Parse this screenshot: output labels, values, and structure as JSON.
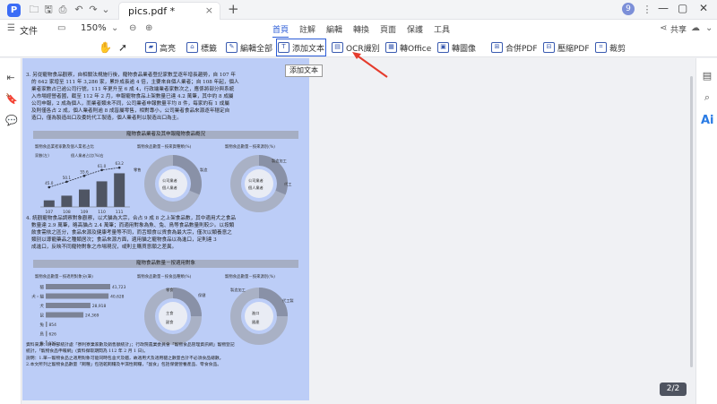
{
  "titlebar": {
    "tab_title": "pics.pdf *",
    "close_glyph": "×",
    "add_glyph": "+",
    "badge": "9",
    "win_min": "—",
    "win_max": "▢",
    "win_close": "✕"
  },
  "menubar": {
    "file": "文件",
    "zoom": "150%",
    "tabs": [
      "首頁",
      "註解",
      "編輯",
      "轉換",
      "頁面",
      "保護",
      "工具"
    ],
    "share": "共享"
  },
  "toolbar": {
    "items": [
      "高亮",
      "標籤",
      "編輯全部",
      "添加文本",
      "OCR識別",
      "轉Office",
      "轉圖像",
      "合併PDF",
      "壓縮PDF",
      "裁剪"
    ]
  },
  "tooltip": "添加文本",
  "page_indicator": "2/2",
  "document": {
    "para3": [
      "3. 另從寵物食品觀察，自相關法規施行後，寵物食品業者登記家數呈逐年增長趨勢，自 107 年",
      "的 642 家增至 111 年 3,286 家，累計成長逾 4 倍，主要來自個人業者；自 108 年起，個人",
      "業者家數占已逾公司行號，111 年更升至 6 成 4，行政端業者家數次之，應係將部分與系統",
      "入市場經營者國，截至 112 年 2 月，申報寵物食品上架數量已達 4.2 萬筆，其中約 8 成屬",
      "公司申報，2 成為個人，而業者類未不同，公司業者申報數量平均 8 件，每家約有 1 成屬",
      "及則僅各占 2 成，個人業者則逾 8 成皆屬零售，相對專小，公司業者食品來源逐年穩定自",
      "造口，僅為製造出口及委託代工製造，個人業者則以製造出口為主。"
    ],
    "band1": "寵物食品業者及其申報寵物食品概況",
    "para4": [
      "4. 統觀寵物食品調察對象觀察，以犬貓為大宗，合占 9 成 8 之上架食品數，其中適用犬之食品",
      "數量達 2.9 萬筆，略高貓占 2.4 萬筆；而適用對象為魚、兔、鳥等食品數量則較少。以按類",
      "飲食需依之區分，食品來源及健康考量等不同，而舌頭食以貨食為最大宗，僅次以類養意之",
      "類別以導寵藥品之種類居次；食品來源方面，適用貓之寵物食品以為進口，足則達 3",
      "成進口，反映不同寵物對象之市場現況，或則主購買意願之差異。"
    ],
    "band2": "寵物食品數量－按適用對象",
    "footnote": [
      "資料來源：財政部統計處「寮利寮業家數及銷售額統計」；行政院農業委員會「寵物食品管理資訊網」寵物登記",
      "        統計，「寵物食品申報網」(資料擷取期間為 112 年 2 月 1 日)。",
      "說明：1.單一寵物食品之適用對象可能同時包含犬及貓，故適用犬及適用貓之數量合計不必須食品總數。",
      "     2.本文所列之寵物食品數量「飼種」包括乾飼糧及半濕性飼糧，「副食」包括保健營養產品、零食食品。"
    ]
  },
  "charts": {
    "c1_title": "寵物食品業者家數及個人業者占比",
    "c2_title": "寵物食品數量－按來貨種類(%)",
    "c3_title": "寵物食品數量－按來源別(%)",
    "c4_title": "寵物食品數量－按適用對象分(筆)",
    "c5_title": "寵物食品數量－按食品種類(%)",
    "c6_title": "寵物食品數量－按來源別(%)",
    "c1_legend": [
      "家數(左)",
      "個人業者占比(%)右"
    ],
    "c2_labels": [
      "公司業者",
      "個人業者",
      "零售",
      "製造"
    ],
    "c3_labels": [
      "公司業者",
      "個人業者",
      "製造加工",
      "代工"
    ],
    "c5_labels": [
      "主食",
      "副食",
      "零食",
      "保健"
    ],
    "c6_labels": [
      "進口",
      "國產",
      "製造加工",
      "代工製"
    ]
  },
  "chart_data": [
    {
      "type": "bar",
      "title": "寵物食品業者家數及個人業者占比",
      "categories": [
        "107",
        "108",
        "109",
        "110",
        "111"
      ],
      "series": [
        {
          "name": "家數(左)",
          "values": [
            642,
            1100,
            1700,
            2500,
            3286
          ]
        },
        {
          "name": "個人業者占比(%)右",
          "values": [
            45.0,
            50.1,
            55.6,
            61.0,
            63.2
          ]
        }
      ],
      "data_labels": [
        "45.0",
        "50.1",
        "55.6",
        "61.0",
        "63.2"
      ]
    },
    {
      "type": "bar",
      "title": "寵物食品數量－按適用對象分(筆)",
      "categories": [
        "貓",
        "犬・貓",
        "犬",
        "鼠",
        "兔",
        "鳥",
        "魚"
      ],
      "values": [
        41723,
        40628,
        28918,
        24369,
        854,
        626,
        123
      ],
      "data_labels": [
        "41,723",
        "40,628",
        "28,918",
        "24,369",
        "854",
        "626",
        "123"
      ]
    }
  ]
}
